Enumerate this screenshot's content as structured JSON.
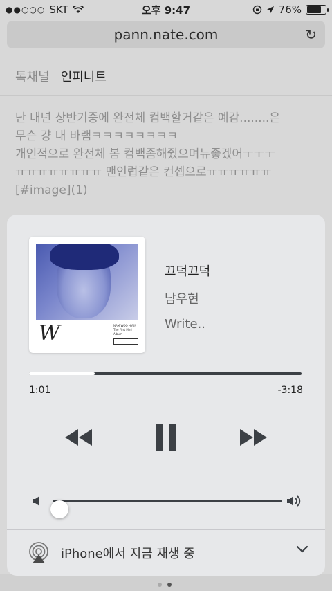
{
  "status_bar": {
    "carrier": "SKT",
    "signal_dots": "●●○○○",
    "time": "오후 9:47",
    "battery": "76%",
    "battery_level": 0.76
  },
  "browser": {
    "url": "pann.nate.com"
  },
  "channel": {
    "label": "톡채널",
    "name": "인피니트"
  },
  "article": {
    "lines": [
      "난 내년 상반기중에 완전체 컴백할거같은 예감........은",
      "무슨 걍 내 바램ㅋㅋㅋㅋㅋㅋㅋㅋ",
      "개인적으로 완전체 봄 컴백좀해줬으며뉴좋겠어ㅜㅜㅜ",
      "ㅠㅠㅠㅠㅠㅠㅠㅠ 맨인럽같은 컨셉으로ㅠㅠㅠㅠㅠㅠ",
      "[#image](1)"
    ]
  },
  "player": {
    "album_art": {
      "letter": "W",
      "artist_line": "NAM WOO HYUN",
      "album_line": "The First Mini Album",
      "logo_text": "Write.."
    },
    "track_title": "끄덕끄덕",
    "artist": "남우현",
    "album": "Write..",
    "elapsed": "1:01",
    "remaining": "-3:18",
    "progress": 0.24,
    "volume": 0.03,
    "output_label": "iPhone에서 지금 재생 중",
    "icons": {
      "rewind": "rewind-icon",
      "pause": "pause-icon",
      "fast_forward": "fast-forward-icon",
      "volume_low": "volume-low-icon",
      "volume_high": "volume-high-icon",
      "airplay": "airplay-icon",
      "chevron": "chevron-down-icon"
    },
    "colors": {
      "card_bg": "#e7e8ea",
      "track_dark": "#3c4045",
      "album_blue": "#4a5ab0"
    }
  }
}
